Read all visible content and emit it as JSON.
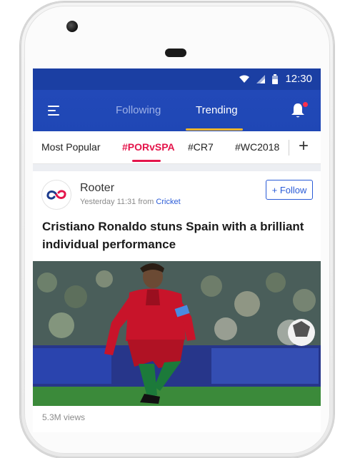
{
  "status": {
    "time": "12:30"
  },
  "appbar": {
    "tabs": [
      {
        "label": "Following",
        "active": false
      },
      {
        "label": "Trending",
        "active": true
      }
    ]
  },
  "tags": {
    "items": [
      "Most Popular",
      "#PORvSPA",
      "#CR7",
      "#WC2018"
    ],
    "active_index": 1,
    "add_label": "+"
  },
  "post": {
    "author": "Rooter",
    "time_prefix": "Yesterday 11:31 from",
    "category": "Cricket",
    "follow_label": "+ Follow",
    "headline": "Cristiano Ronaldo stuns Spain with a brilliant individual performance",
    "views": "5.3M views"
  },
  "colors": {
    "brand_blue": "#1f47b5",
    "accent_pink": "#e4154b",
    "tab_underline": "#f2b52c",
    "link_blue": "#2a5bd7"
  }
}
